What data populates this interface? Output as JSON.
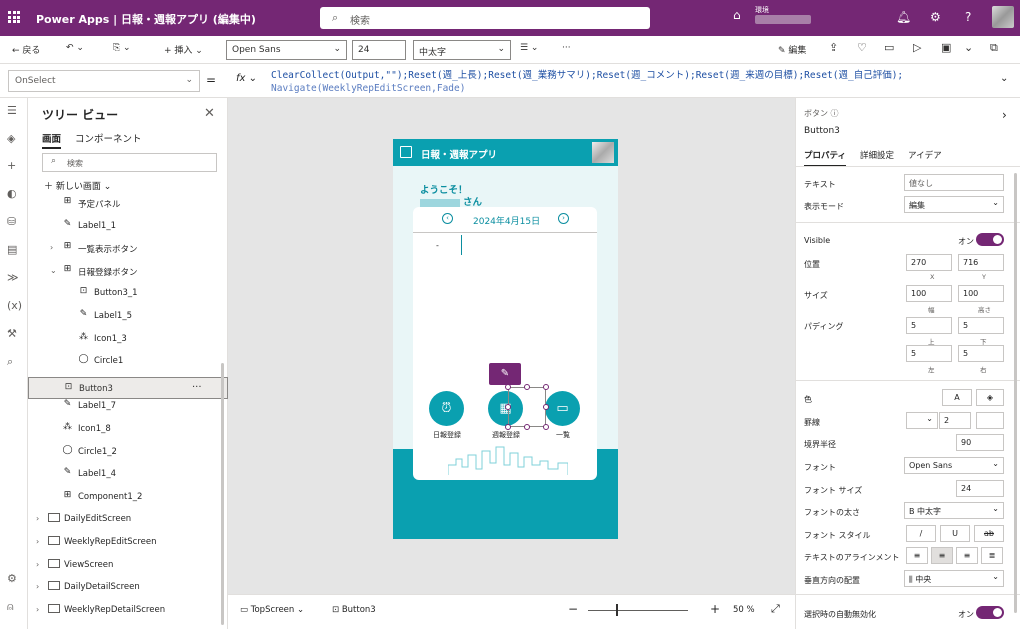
{
  "header": {
    "app_name": "Power Apps | 日報・週報アプリ (編集中)",
    "search_placeholder": "検索",
    "env_label": "環境"
  },
  "toolbar": {
    "back": "戻る",
    "insert": "挿入",
    "font": "Open Sans",
    "font_size": "24",
    "font_weight": "中太字",
    "edit": "編集"
  },
  "formula": {
    "property": "OnSelect",
    "line1": "ClearCollect(Output,\"\");Reset(週_上長);Reset(週_業務サマリ);Reset(週_コメント);Reset(週_来週の目標);Reset(週_自己評価);",
    "line2": "Navigate(WeeklyRepEditScreen,Fade)"
  },
  "tree": {
    "title": "ツリー ビュー",
    "tabs": [
      "画面",
      "コンポーネント"
    ],
    "search_placeholder": "検索",
    "new_screen": "新しい画面",
    "items": [
      {
        "label": "予定パネル",
        "indent": 2,
        "icon": "group"
      },
      {
        "label": "Label1_1",
        "indent": 2,
        "icon": "label"
      },
      {
        "label": "一覧表示ボタン",
        "indent": 2,
        "icon": "group",
        "caret": "›"
      },
      {
        "label": "日報登録ボタン",
        "indent": 2,
        "icon": "group",
        "caret": "⌄"
      },
      {
        "label": "Button3_1",
        "indent": 3,
        "icon": "button"
      },
      {
        "label": "Label1_5",
        "indent": 3,
        "icon": "label"
      },
      {
        "label": "Icon1_3",
        "indent": 3,
        "icon": "icon"
      },
      {
        "label": "Circle1",
        "indent": 3,
        "icon": "shape"
      },
      {
        "label": "Button3",
        "indent": 2,
        "icon": "button",
        "selected": true
      },
      {
        "label": "Label1_7",
        "indent": 2,
        "icon": "label"
      },
      {
        "label": "Icon1_8",
        "indent": 2,
        "icon": "icon"
      },
      {
        "label": "Circle1_2",
        "indent": 2,
        "icon": "shape"
      },
      {
        "label": "Label1_4",
        "indent": 2,
        "icon": "label"
      },
      {
        "label": "Component1_2",
        "indent": 2,
        "icon": "component"
      },
      {
        "label": "DailyEditScreen",
        "indent": 1,
        "icon": "screen",
        "caret": "›"
      },
      {
        "label": "WeeklyRepEditScreen",
        "indent": 1,
        "icon": "screen",
        "caret": "›"
      },
      {
        "label": "ViewScreen",
        "indent": 1,
        "icon": "screen",
        "caret": "›"
      },
      {
        "label": "DailyDetailScreen",
        "indent": 1,
        "icon": "screen",
        "caret": "›"
      },
      {
        "label": "WeeklyRepDetailScreen",
        "indent": 1,
        "icon": "screen",
        "caret": "›"
      }
    ]
  },
  "app": {
    "title": "日報・週報アプリ",
    "welcome": "ようこそ！",
    "user_suffix": "さん",
    "date": "2024年4月15日",
    "buttons": [
      "日報登録",
      "週報登録",
      "一覧"
    ]
  },
  "status": {
    "screen": "TopScreen",
    "control": "Button3",
    "zoom": "50",
    "zoom_unit": "%"
  },
  "props": {
    "type": "ボタン",
    "name": "Button3",
    "tabs": [
      "プロパティ",
      "詳細設定",
      "アイデア"
    ],
    "text_label": "テキスト",
    "text_value": "値なし",
    "display_mode_label": "表示モード",
    "display_mode": "編集",
    "visible_label": "Visible",
    "visible_state": "オン",
    "position_label": "位置",
    "x": "270",
    "y": "716",
    "x_lbl": "X",
    "y_lbl": "Y",
    "size_label": "サイズ",
    "w": "100",
    "h": "100",
    "w_lbl": "幅",
    "h_lbl": "高さ",
    "padding_label": "パディング",
    "p_top": "5",
    "p_bottom": "5",
    "p_left": "5",
    "p_right": "5",
    "p_top_lbl": "上",
    "p_bottom_lbl": "下",
    "p_left_lbl": "左",
    "p_right_lbl": "右",
    "color_label": "色",
    "color_a": "A",
    "border_label": "罫線",
    "border_width": "2",
    "radius_label": "境界半径",
    "radius": "90",
    "font_label": "フォント",
    "font": "Open Sans",
    "fontsize_label": "フォント サイズ",
    "fontsize": "24",
    "weight_label": "フォントの太さ",
    "weight": "B 中太字",
    "style_label": "フォント スタイル",
    "style_i": "/",
    "style_u": "U",
    "style_s": "ab",
    "align_label": "テキストのアラインメント",
    "valign_label": "垂直方向の配置",
    "valign": "中央",
    "autodisable_label": "選択時の自動無効化",
    "autodisable": "オン"
  }
}
